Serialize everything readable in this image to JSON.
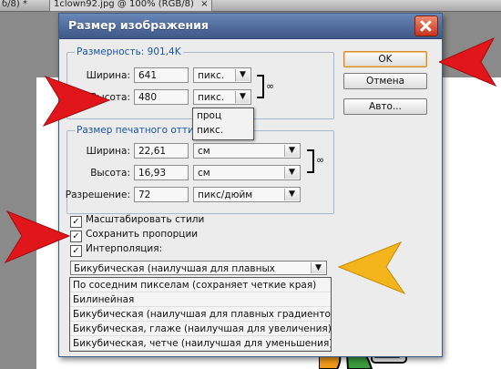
{
  "tabs": [
    {
      "label": "б/8) *",
      "active": false
    },
    {
      "label": "1clown92.jpg @ 100% (RGB/8)",
      "active": true
    }
  ],
  "dialog": {
    "title": "Размер изображения",
    "dimensions": {
      "legend": "Размерность:  901,4K",
      "width_label": "Ширина:",
      "width_value": "641",
      "width_unit": "пикс.",
      "height_label": "Высота:",
      "height_value": "480",
      "height_unit": "пикс."
    },
    "unit_popup": [
      "проц",
      "пикс."
    ],
    "print": {
      "legend": "Размер печатного оттиска",
      "width_label": "Ширина:",
      "width_value": "22,61",
      "width_unit": "см",
      "height_label": "Высота:",
      "height_value": "16,93",
      "height_unit": "см",
      "res_label": "Разрешение:",
      "res_value": "72",
      "res_unit": "пикс/дюйм"
    },
    "buttons": {
      "ok": "OK",
      "cancel": "Отмена",
      "auto": "Авто..."
    },
    "checks": [
      {
        "label": "Масштабировать стили",
        "checked": true
      },
      {
        "label": "Сохранить пропорции",
        "checked": true
      },
      {
        "label": "Интерполяция:",
        "checked": true
      }
    ],
    "interpolation_selected": "Бикубическая (наилучшая для плавных градиентов)",
    "interpolation_options": [
      "По соседним пикселам (сохраняет четкие края)",
      "Билинейная",
      "Бикубическая (наилучшая для плавных градиентов)",
      "Бикубическая, глаже (наилучшая для увеличения)",
      "Бикубическая, четче (наилучшая для уменьшения)"
    ]
  },
  "colors": {
    "arrow_red": "#e0161b",
    "arrow_yellow": "#f3b51b",
    "titlebar": "#4f6b9c",
    "legend_blue": "#1b54a8"
  }
}
